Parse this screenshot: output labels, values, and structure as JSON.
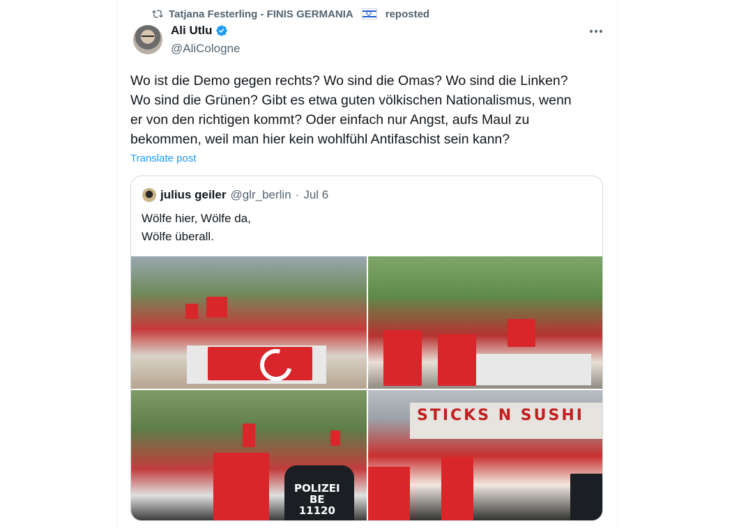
{
  "repost": {
    "icon": "repost-icon",
    "name": "Tatjana Festerling - FINIS GERMANIA",
    "flag": "israel-flag-icon",
    "suffix": "reposted"
  },
  "author": {
    "name": "Ali Utlu",
    "handle": "@AliCologne",
    "verified_icon": "verified-badge-icon"
  },
  "tweet": {
    "text": "Wo ist die Demo gegen rechts? Wo sind die Omas? Wo sind die Linken?\nWo sind die Grünen? Gibt es etwa guten völkischen Nationalismus, wenn\ner von den richtigen kommt? Oder einfach nur Angst, aufs Maul zu\nbekommen, weil man hier kein wohlfühl Antifaschist sein kann?",
    "translate_label": "Translate post"
  },
  "quote": {
    "name": "julius geiler",
    "handle": "@glr_berlin",
    "separator": "·",
    "date": "Jul 6",
    "text": "Wölfe hier, Wölfe da,\nWölfe überall."
  },
  "photos": {
    "sign": "STICKS N SUSHI",
    "police": "POLIZEI\nBE\n11120"
  },
  "colors": {
    "link": "#1d9bf0",
    "muted": "#536471",
    "text": "#0f1419",
    "border": "#cfd9de"
  }
}
